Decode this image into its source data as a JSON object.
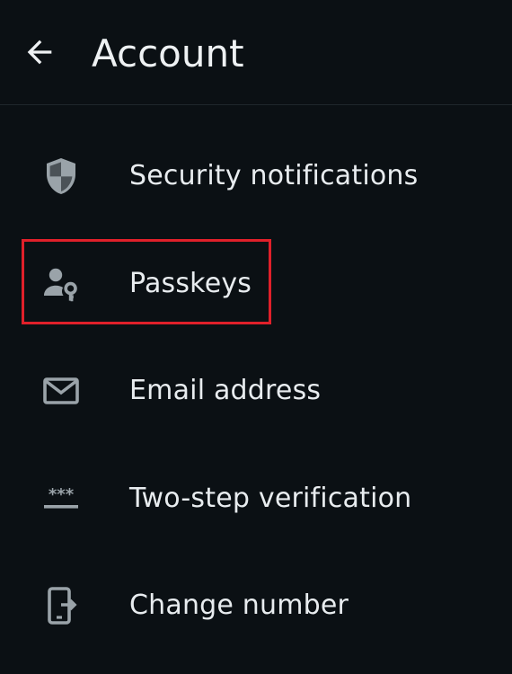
{
  "header": {
    "title": "Account",
    "back_icon": "arrow-left-icon"
  },
  "menu": {
    "items": [
      {
        "label": "Security notifications",
        "icon": "shield-icon"
      },
      {
        "label": "Passkeys",
        "icon": "person-key-icon"
      },
      {
        "label": "Email address",
        "icon": "envelope-icon"
      },
      {
        "label": "Two-step verification",
        "icon": "password-asterisks-icon"
      },
      {
        "label": "Change number",
        "icon": "phone-transfer-icon"
      }
    ]
  },
  "colors": {
    "background": "#0b1014",
    "icon": "#9aa3a9",
    "text": "#e8ecef",
    "highlight": "#e0202a"
  }
}
